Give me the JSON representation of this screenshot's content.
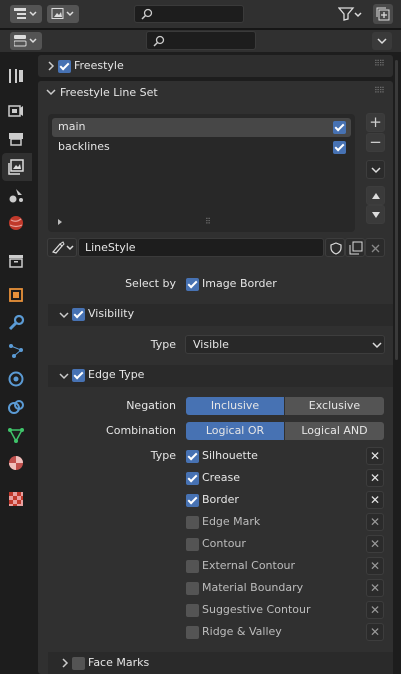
{
  "header": {
    "search_placeholder": ""
  },
  "props_header": {
    "search_placeholder": ""
  },
  "freestyle_panel": {
    "label": "Freestyle",
    "enabled": true
  },
  "lineset_panel": {
    "label": "Freestyle Line Set"
  },
  "linesets": [
    {
      "name": "main",
      "checked": true
    },
    {
      "name": "backlines",
      "checked": true
    }
  ],
  "linestyle": {
    "value": "LineStyle"
  },
  "select_by": {
    "label": "Select by",
    "image_border_label": "Image Border",
    "image_border": true
  },
  "visibility": {
    "label": "Visibility",
    "enabled": true,
    "type_label": "Type",
    "type_value": "Visible"
  },
  "edge_type": {
    "label": "Edge Type",
    "enabled": true,
    "negation_label": "Negation",
    "negation_options": [
      "Inclusive",
      "Exclusive"
    ],
    "negation_selected": "Inclusive",
    "combination_label": "Combination",
    "combination_options": [
      "Logical OR",
      "Logical AND"
    ],
    "combination_selected": "Logical OR",
    "type_label": "Type",
    "types": [
      {
        "label": "Silhouette",
        "checked": true
      },
      {
        "label": "Crease",
        "checked": true
      },
      {
        "label": "Border",
        "checked": true
      },
      {
        "label": "Edge Mark",
        "checked": false
      },
      {
        "label": "Contour",
        "checked": false
      },
      {
        "label": "External Contour",
        "checked": false
      },
      {
        "label": "Material Boundary",
        "checked": false
      },
      {
        "label": "Suggestive Contour",
        "checked": false
      },
      {
        "label": "Ridge & Valley",
        "checked": false
      }
    ]
  },
  "face_marks": {
    "label": "Face Marks",
    "enabled": false
  },
  "colors": {
    "accent": "#4772b3",
    "panel_bg": "#303030",
    "window_bg": "#1d1d1d"
  }
}
